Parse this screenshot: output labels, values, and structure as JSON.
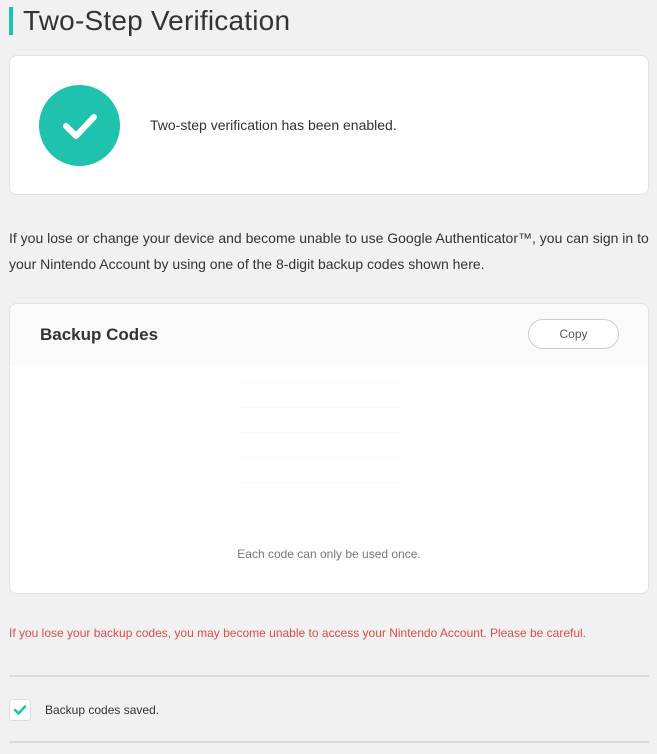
{
  "page": {
    "title": "Two-Step Verification"
  },
  "status": {
    "icon": "checkmark-icon",
    "message": "Two-step verification has been enabled."
  },
  "info": {
    "text": "If you lose or change your device and become unable to use Google Authenticator™, you can sign in to your Nintendo Account by using one of the 8-digit backup codes shown here."
  },
  "backup_codes": {
    "heading": "Backup Codes",
    "copy_label": "Copy",
    "note": "Each code can only be used once."
  },
  "warning": {
    "text": "If you lose your backup codes, you may become unable to access your Nintendo Account. Please be careful."
  },
  "confirmation": {
    "checked": true,
    "icon": "checkmark-icon",
    "label": "Backup codes saved."
  },
  "colors": {
    "accent": "#1fc3ad",
    "warning": "#e04a4a",
    "background": "#f1f1f1"
  }
}
